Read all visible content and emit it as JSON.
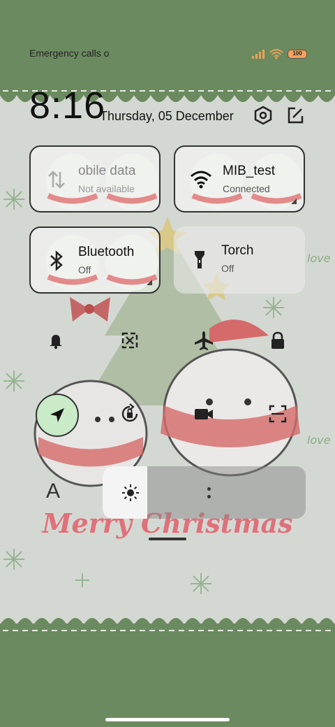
{
  "status_bar": {
    "carrier_text": "Emergency calls o",
    "signal_icon": "signal-bars-icon",
    "wifi_icon": "wifi-icon",
    "battery_level": "100",
    "battery_color": "#f5a25a"
  },
  "header": {
    "time": "8:16",
    "date": "Thursday, 05 December",
    "settings_icon": "settings-hexagon-icon",
    "edit_icon": "edit-icon"
  },
  "tiles": [
    {
      "name": "obile data",
      "status": "Not available",
      "icon": "mobile-data-icon",
      "active": false
    },
    {
      "name": "MIB_test",
      "status": "Connected",
      "icon": "wifi-icon",
      "active": true
    },
    {
      "name": "Bluetooth",
      "status": "Off",
      "icon": "bluetooth-icon",
      "active": true
    },
    {
      "name": "Torch",
      "status": "Off",
      "icon": "torch-icon",
      "active": false
    }
  ],
  "quick_toggles_row1": [
    "bell-icon",
    "screenshot-icon",
    "airplane-icon",
    "lock-icon"
  ],
  "quick_toggles_row2": [
    "location-icon",
    "auto-rotate-icon",
    "video-camera-icon",
    "scan-icon"
  ],
  "controls": {
    "font_size_label": "A",
    "brightness_icon": "brightness-icon",
    "brightness_level_percent": 22
  },
  "wallpaper": {
    "greeting": "Merry Christmas",
    "accent_green": "#6c8a5f",
    "accent_red": "#e0707a"
  }
}
